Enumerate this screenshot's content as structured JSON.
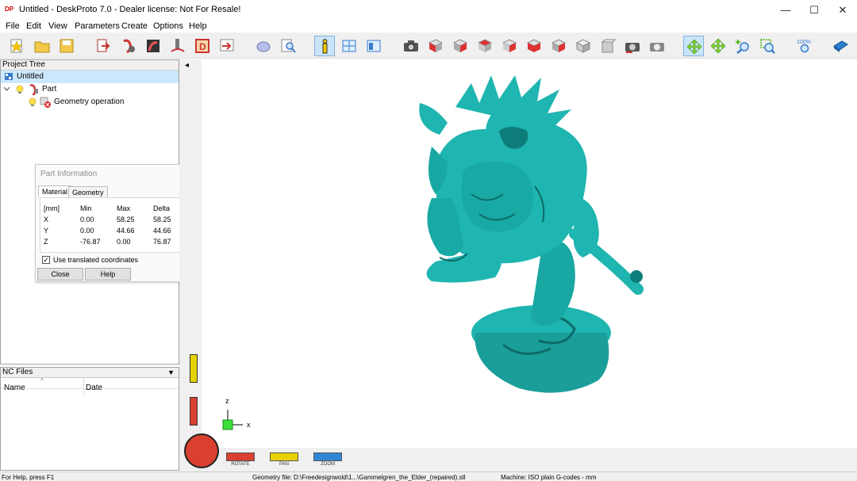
{
  "window": {
    "icon_text": "DP",
    "title": "Untitled - DeskProto 7.0 - Dealer license: Not For Resale!",
    "minimize": "—",
    "maximize": "☐",
    "close": "✕"
  },
  "menu": [
    "File",
    "Edit",
    "View",
    "Parameters",
    "Create",
    "Options",
    "Help"
  ],
  "toolbar": {
    "icons": [
      "new-icon",
      "open-icon",
      "save-icon",
      "import-icon",
      "part-params-icon",
      "rendering-icon",
      "toolpath-icon",
      "drawing-icon",
      "export-icon",
      "hide-icon",
      "find-icon",
      "info-icon",
      "layout-icon",
      "window-icon",
      "snapshot-icon",
      "view-red-1-icon",
      "view-red-2-icon",
      "view-red-3-icon",
      "view-red-4-icon",
      "view-red-5-icon",
      "view-red-6-icon",
      "view-iso-1-icon",
      "view-iso-2-icon",
      "rotate-view-1-icon",
      "rotate-view-2-icon",
      "move-icon",
      "pan-icon",
      "zoom-in-icon",
      "zoom-window-icon",
      "zoom-100-icon",
      "book-icon"
    ],
    "zoom_label": "100%"
  },
  "project_tree": {
    "title": "Project Tree",
    "root": "Untitled",
    "part": "Part",
    "operation": "Geometry operation"
  },
  "part_info": {
    "title": "Part Information",
    "tabs": [
      "Material",
      "Geometry"
    ],
    "active_tab": "Material",
    "headers": [
      "[mm]",
      "Min",
      "Max",
      "Delta"
    ],
    "rows": [
      [
        "X",
        "0.00",
        "58.25",
        "58.25"
      ],
      [
        "Y",
        "0.00",
        "44.66",
        "44.66"
      ],
      [
        "Z",
        "-76.87",
        "0.00",
        "76.87"
      ]
    ],
    "use_translated_label": "Use translated coordinates",
    "use_translated_checked": true,
    "check_mark": "✓",
    "close_label": "Close",
    "help_label": "Help",
    "more_arrow": "▼"
  },
  "nc_files": {
    "title": "NC Files",
    "columns": [
      "Name",
      "Date"
    ],
    "dropdown": "▼",
    "sort_arrow": "^"
  },
  "viewport": {
    "model_color": "#1fb5b0",
    "axis_z": "z",
    "axis_x": "x",
    "collapse_arrow": "◂"
  },
  "bottom_controls": {
    "rotate": "ROTATE",
    "pan": "PAN",
    "zoom": "ZOOM",
    "rotate_color": "#d94030",
    "pan_color": "#e6d200",
    "zoom_color": "#2f86d6"
  },
  "statusbar": {
    "help": "For Help, press F1",
    "geometry_file": "Geometry file: D:\\Freedesignwold\\1...\\Gammelgren_the_Elder_(repaired).stl",
    "machine": "Machine: ISO plain G-codes - mm"
  }
}
